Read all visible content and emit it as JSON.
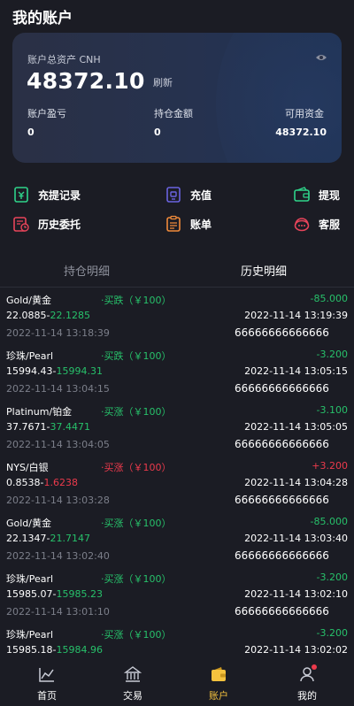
{
  "header": {
    "title": "我的账户"
  },
  "account": {
    "total_label": "账户总资产 CNH",
    "total_value": "48372.10",
    "refresh_label": "刷新",
    "pnl_label": "账户盈亏",
    "pnl_value": "0",
    "position_amount_label": "持仓金额",
    "position_amount_value": "0",
    "available_label": "可用资金",
    "available_value": "48372.10"
  },
  "actions": [
    {
      "label": "充提记录",
      "icon": "deposit-withdraw-record-icon",
      "color": "#2fd38a"
    },
    {
      "label": "充值",
      "icon": "recharge-icon",
      "color": "#6a63e0"
    },
    {
      "label": "提现",
      "icon": "withdraw-icon",
      "color": "#2fd38a"
    },
    {
      "label": "历史委托",
      "icon": "history-orders-icon",
      "color": "#e8445a"
    },
    {
      "label": "账单",
      "icon": "bill-icon",
      "color": "#f08a3a"
    },
    {
      "label": "客服",
      "icon": "customer-service-icon",
      "color": "#e8445a"
    }
  ],
  "tabs": {
    "positions": "持仓明细",
    "history": "历史明细"
  },
  "trades": [
    {
      "name": "Gold/黄金",
      "direction": "·买跌（￥100）",
      "pnl": "-85.000",
      "open_price": "22.0885-",
      "close_price": "22.1285",
      "close_time": "2022-11-14 13:19:39",
      "open_time": "2022-11-14 13:18:39",
      "order_no": "66666666666666"
    },
    {
      "name": "珍珠/Pearl",
      "direction": "·买跌（￥100）",
      "pnl": "-3.200",
      "open_price": "15994.43-",
      "close_price": "15994.31",
      "close_time": "2022-11-14 13:05:15",
      "open_time": "2022-11-14 13:04:15",
      "order_no": "66666666666666"
    },
    {
      "name": "Platinum/铂金",
      "direction": "·买涨（￥100）",
      "pnl": "-3.100",
      "open_price": "37.7671-",
      "close_price": "37.4471",
      "close_time": "2022-11-14 13:05:05",
      "open_time": "2022-11-14 13:04:05",
      "order_no": "66666666666666"
    },
    {
      "name": "NYS/白银",
      "direction": "·买涨（￥100）",
      "pnl": "+3.200",
      "open_price": "0.8538-",
      "close_price": "1.6238",
      "close_time": "2022-11-14 13:04:28",
      "open_time": "2022-11-14 13:03:28",
      "order_no": "66666666666666"
    },
    {
      "name": "Gold/黄金",
      "direction": "·买涨（￥100）",
      "pnl": "-85.000",
      "open_price": "22.1347-",
      "close_price": "21.7147",
      "close_time": "2022-11-14 13:03:40",
      "open_time": "2022-11-14 13:02:40",
      "order_no": "66666666666666"
    },
    {
      "name": "珍珠/Pearl",
      "direction": "·买涨（￥100）",
      "pnl": "-3.200",
      "open_price": "15985.07-",
      "close_price": "15985.23",
      "close_time": "2022-11-14 13:02:10",
      "open_time": "2022-11-14 13:01:10",
      "order_no": "66666666666666"
    },
    {
      "name": "珍珠/Pearl",
      "direction": "·买涨（￥100）",
      "pnl": "-3.200",
      "open_price": "15985.18-",
      "close_price": "15984.96",
      "close_time": "2022-11-14 13:02:02",
      "open_time": "",
      "order_no": ""
    }
  ],
  "nav": [
    {
      "label": "首页",
      "icon": "home-chart-icon"
    },
    {
      "label": "交易",
      "icon": "bank-icon"
    },
    {
      "label": "账户",
      "icon": "wallet-icon"
    },
    {
      "label": "我的",
      "icon": "user-icon"
    }
  ],
  "colors": {
    "background": "#1b1c24",
    "profit_green": "#27c06a",
    "loss_red": "#ec3a4c",
    "active_nav": "#f5c23e",
    "muted_text": "#7c7f8a"
  }
}
